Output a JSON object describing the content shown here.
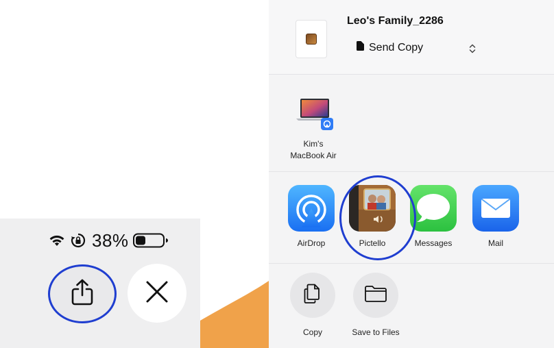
{
  "status_bar": {
    "battery_percent": "38%",
    "battery_level": 0.38
  },
  "toolbar": {
    "share_icon": "share-icon",
    "close_icon": "close-icon"
  },
  "share_sheet": {
    "document_title": "Leo's Family_2286",
    "send_option": "Send Copy",
    "devices": [
      {
        "line1": "Kim's",
        "line2": "MacBook Air"
      }
    ],
    "apps": [
      {
        "label": "AirDrop"
      },
      {
        "label": "Pictello"
      },
      {
        "label": "Messages"
      },
      {
        "label": "Mail"
      }
    ],
    "actions": [
      {
        "label": "Copy",
        "icon": "copy-icon"
      },
      {
        "label": "Save to Files",
        "icon": "folder-icon"
      }
    ]
  },
  "colors": {
    "highlight_ring": "#1f3ed0",
    "accent_orange": "#f0a24a"
  }
}
